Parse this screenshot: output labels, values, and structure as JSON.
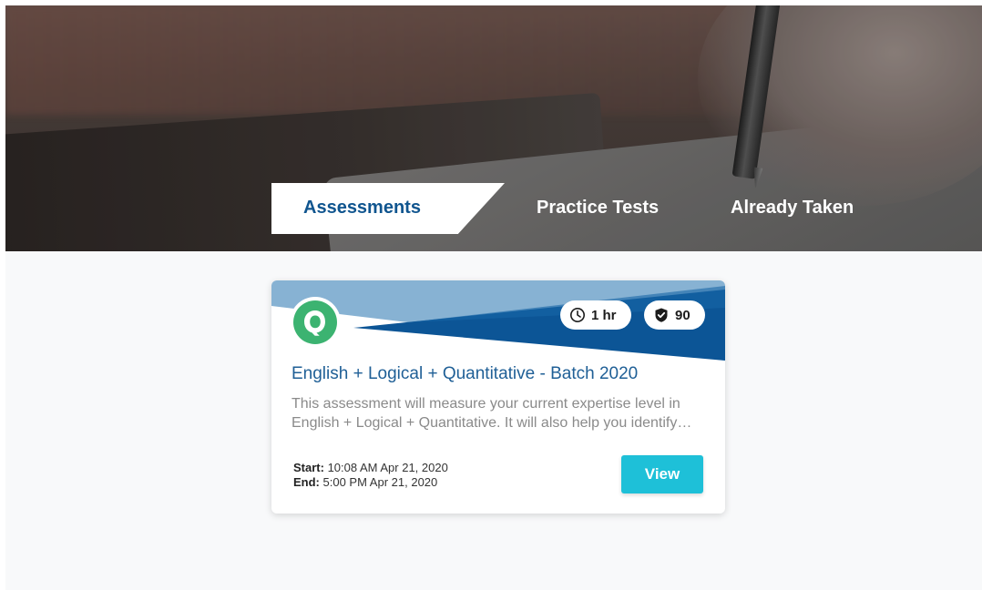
{
  "tabs": {
    "active": "Assessments",
    "items": [
      {
        "label": "Assessments"
      },
      {
        "label": "Practice Tests"
      },
      {
        "label": "Already Taken"
      }
    ]
  },
  "card": {
    "logo_icon": "q-logo-icon",
    "duration_badge": {
      "icon": "clock-icon",
      "label": "1 hr"
    },
    "score_badge": {
      "icon": "shield-check-icon",
      "label": "90"
    },
    "title": "English + Logical + Quantitative - Batch 2020",
    "description": "This assessment will measure your current expertise level in English + Logical + Quantitative. It will also help you identify your strengths and areas of improvement.",
    "start_label": "Start:",
    "start_value": "10:08 AM Apr 21, 2020",
    "end_label": "End:",
    "end_value": "5:00 PM Apr 21, 2020",
    "view_label": "View"
  },
  "colors": {
    "brand_blue": "#10558f",
    "header_blue_dark": "#0c5596",
    "header_blue_light": "#87b2d3",
    "logo_green": "#3cb371",
    "button_cyan": "#1ec0d8"
  }
}
